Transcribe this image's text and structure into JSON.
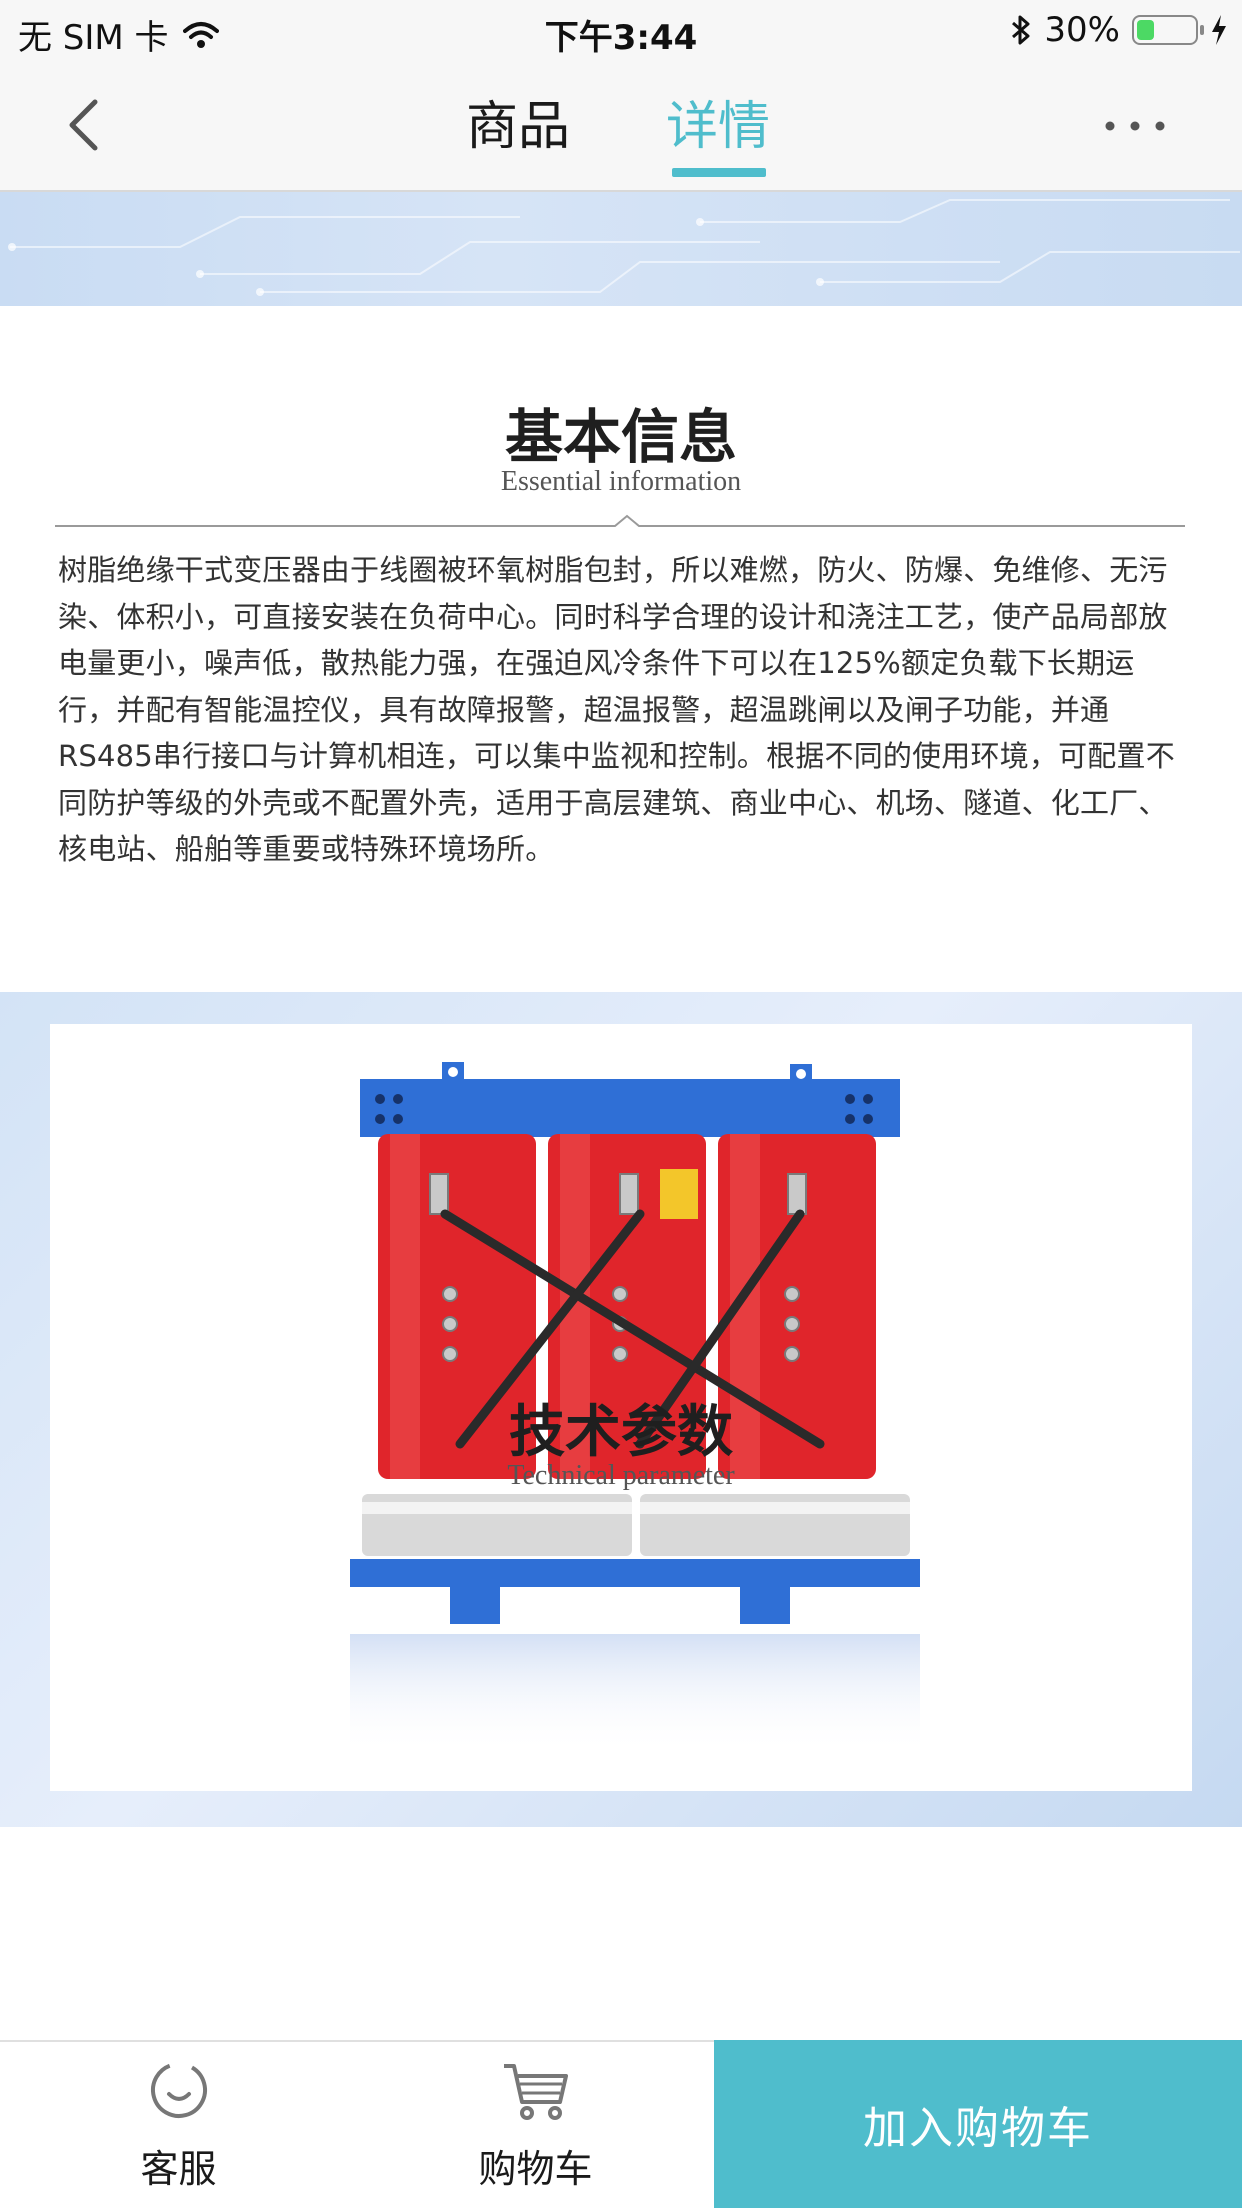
{
  "status_bar": {
    "carrier": "无 SIM 卡",
    "time": "下午3:44",
    "battery_percent": "30%",
    "battery_level": 0.3
  },
  "nav": {
    "tab_goods": "商品",
    "tab_detail": "详情",
    "active_tab": "详情"
  },
  "sections": {
    "basic_title": "基本信息",
    "basic_subtitle": "Essential information",
    "basic_description": "树脂绝缘干式变压器由于线圈被环氧树脂包封，所以难燃，防火、防爆、免维修、无污染、体积小，可直接安装在负荷中心。同时科学合理的设计和浇注工艺，使产品局部放电量更小，噪声低，散热能力强，在强迫风冷条件下可以在125%额定负载下长期运行，并配有智能温控仪，具有故障报警，超温报警，超温跳闸以及闸子功能，并通RS485串行接口与计算机相连，可以集中监视和控制。根据不同的使用环境，可配置不同防护等级的外壳或不配置外壳，适用于高层建筑、商业中心、机场、隧道、化工厂、核电站、船舶等重要或特殊环境场所。",
    "tech_title": "技术参数",
    "tech_subtitle": "Technical parameter"
  },
  "bottom_bar": {
    "service_label": "客服",
    "cart_label": "购物车",
    "add_to_cart_label": "加入购物车"
  },
  "colors": {
    "accent": "#4fbdcc",
    "transformer_red": "#e0252b",
    "frame_blue": "#2f6fd6"
  },
  "icons": [
    "back-icon",
    "more-icon",
    "wifi-icon",
    "bluetooth-icon",
    "charging-icon",
    "service-icon",
    "cart-icon"
  ]
}
